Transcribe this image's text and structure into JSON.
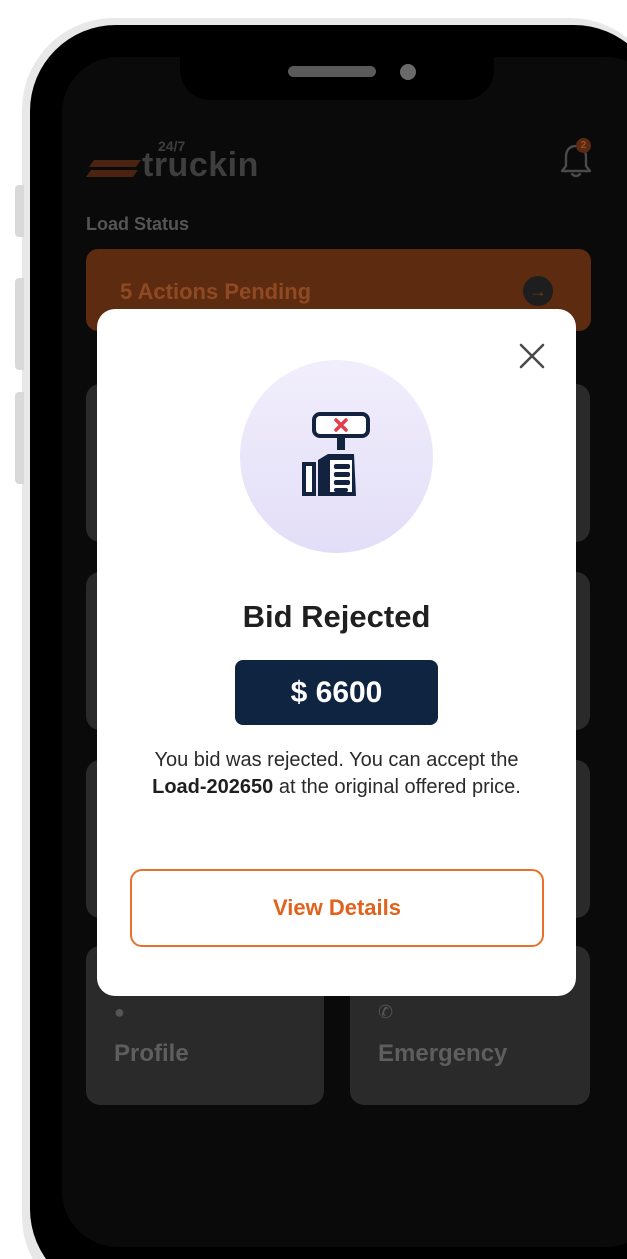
{
  "app": {
    "logo_word": "truckin",
    "logo_superscript": "24/7",
    "notification_count": "2",
    "load_status_label": "Load Status",
    "pending_banner": "5 Actions Pending",
    "tiles": [
      {
        "label": "Profile"
      },
      {
        "label": "Emergency"
      }
    ]
  },
  "modal": {
    "title": "Bid Rejected",
    "price": "$ 6600",
    "description_before": "You bid was rejected. You can accept the ",
    "description_load": "Load-202650",
    "description_after": " at the original offered price.",
    "button_label": "View Details",
    "icon": "bid-rejected-hand-sign-icon",
    "close_icon": "close-icon"
  },
  "colors": {
    "accent_orange": "#e0621c",
    "price_bg_navy": "#0f2440",
    "icon_circle_bg": "#e9e5fa",
    "overlay_dark": "#0a0a0a"
  }
}
